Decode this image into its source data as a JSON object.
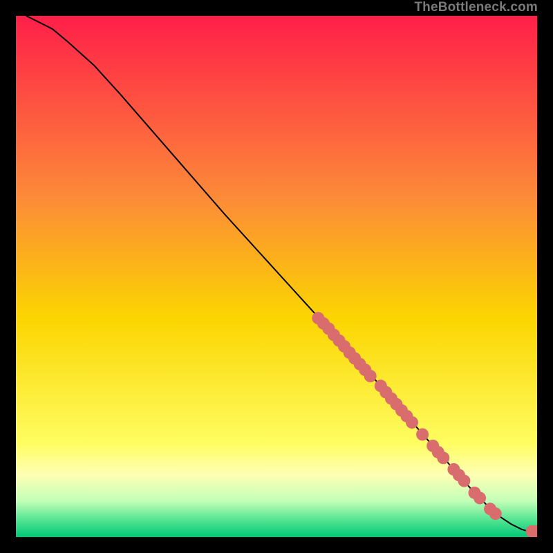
{
  "watermark": "TheBottleneck.com",
  "chart_data": {
    "type": "line",
    "title": "",
    "xlabel": "",
    "ylabel": "",
    "xlim": [
      0,
      100
    ],
    "ylim": [
      0,
      100
    ],
    "background_gradient": {
      "stops": [
        {
          "pos": 0.0,
          "color": "#ff1f49"
        },
        {
          "pos": 0.35,
          "color": "#fc8b38"
        },
        {
          "pos": 0.58,
          "color": "#fbd500"
        },
        {
          "pos": 0.82,
          "color": "#fffd61"
        },
        {
          "pos": 0.88,
          "color": "#feffb4"
        },
        {
          "pos": 0.93,
          "color": "#c4ffb8"
        },
        {
          "pos": 0.97,
          "color": "#4be28f"
        },
        {
          "pos": 1.0,
          "color": "#00c877"
        }
      ]
    },
    "series": [
      {
        "name": "bottleneck-curve",
        "color": "#000000",
        "x": [
          2,
          4,
          7,
          10,
          15,
          20,
          30,
          40,
          50,
          60,
          70,
          80,
          88,
          92,
          95,
          97,
          98,
          99,
          100
        ],
        "y": [
          100,
          99,
          97.5,
          95,
          90.5,
          85,
          73.5,
          62,
          51,
          40,
          29,
          17.5,
          8.5,
          4.5,
          2.5,
          1.5,
          1.2,
          1.1,
          1.1
        ]
      }
    ],
    "markers": {
      "name": "highlighted-points",
      "color": "#d96c6c",
      "radius": 1.2,
      "points": [
        {
          "x": 58,
          "y": 42.0
        },
        {
          "x": 59,
          "y": 41.0
        },
        {
          "x": 60,
          "y": 40.0
        },
        {
          "x": 61,
          "y": 38.8
        },
        {
          "x": 62,
          "y": 37.7
        },
        {
          "x": 63,
          "y": 36.6
        },
        {
          "x": 64,
          "y": 35.4
        },
        {
          "x": 65,
          "y": 34.3
        },
        {
          "x": 66,
          "y": 33.2
        },
        {
          "x": 67,
          "y": 32.1
        },
        {
          "x": 68,
          "y": 30.9
        },
        {
          "x": 70,
          "y": 29.0
        },
        {
          "x": 71,
          "y": 27.8
        },
        {
          "x": 72,
          "y": 26.6
        },
        {
          "x": 73,
          "y": 25.5
        },
        {
          "x": 74,
          "y": 24.3
        },
        {
          "x": 75,
          "y": 23.2
        },
        {
          "x": 76,
          "y": 22.0
        },
        {
          "x": 78,
          "y": 19.7
        },
        {
          "x": 80,
          "y": 17.5
        },
        {
          "x": 81,
          "y": 16.3
        },
        {
          "x": 82,
          "y": 15.2
        },
        {
          "x": 84,
          "y": 13.0
        },
        {
          "x": 85,
          "y": 11.9
        },
        {
          "x": 86,
          "y": 10.8
        },
        {
          "x": 88,
          "y": 8.5
        },
        {
          "x": 89,
          "y": 7.5
        },
        {
          "x": 91,
          "y": 5.4
        },
        {
          "x": 92,
          "y": 4.5
        },
        {
          "x": 99,
          "y": 1.1
        },
        {
          "x": 100,
          "y": 1.1
        }
      ]
    }
  }
}
